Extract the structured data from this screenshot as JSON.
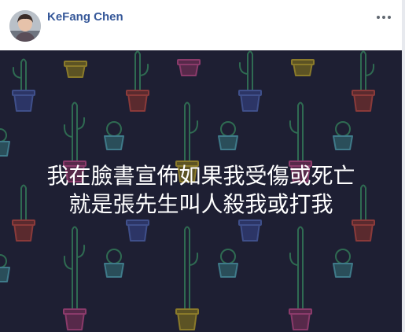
{
  "post": {
    "author_name": "KeFang Chen",
    "avatar_icon": "profile-photo-icon",
    "more_icon": "more-options-icon"
  },
  "image": {
    "background_color": "#1e1f33",
    "caption_line1": "我在臉書宣佈如果我受傷或死亡",
    "caption_line2": "就是張先生叫人殺我或打我",
    "pattern_icon": "cactus-pot-icon"
  }
}
